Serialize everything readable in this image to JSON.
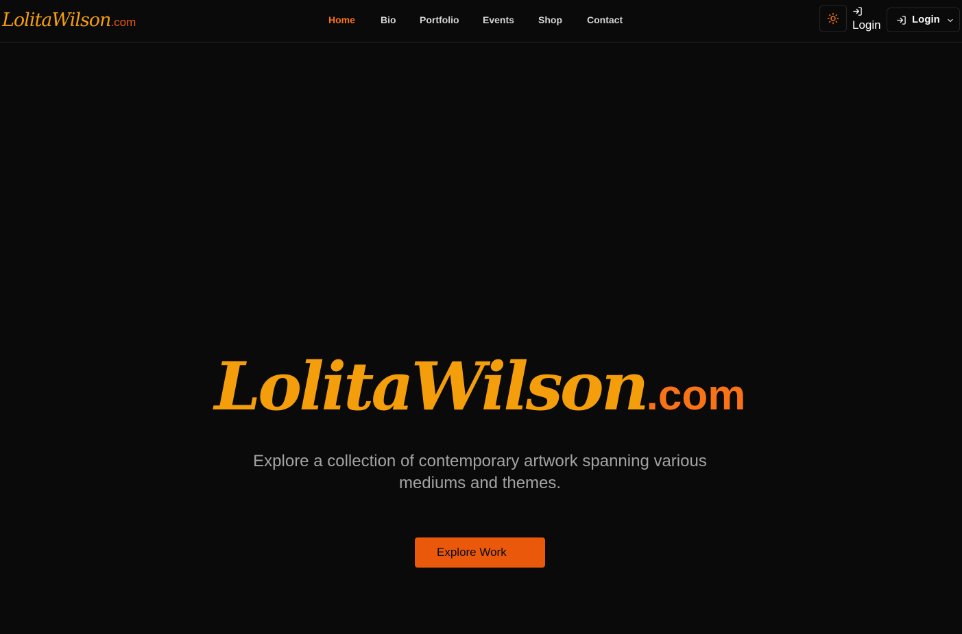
{
  "brand": {
    "name": "LolitaWilson",
    "tld": ".com"
  },
  "nav": {
    "items": [
      {
        "label": "Home",
        "active": true
      },
      {
        "label": "Bio"
      },
      {
        "label": "Portfolio"
      },
      {
        "label": "Events"
      },
      {
        "label": "Shop"
      },
      {
        "label": "Contact"
      }
    ]
  },
  "header_actions": {
    "theme_toggle_icon": "sun-icon",
    "login_link_label": "Login",
    "login_button_label": "Login",
    "login_icon": "log-in-icon",
    "dropdown_icon": "chevron-down-icon"
  },
  "hero": {
    "title_name": "LolitaWilson",
    "title_tld": ".com",
    "subtitle": "Explore a collection of contemporary artwork spanning various mediums and themes.",
    "cta_label": "Explore Work"
  },
  "colors": {
    "background": "#0a0a0a",
    "accent": "#f97316",
    "accent_gold": "#f59e0b",
    "cta": "#ea580c",
    "muted_text": "#a3a3a3"
  }
}
